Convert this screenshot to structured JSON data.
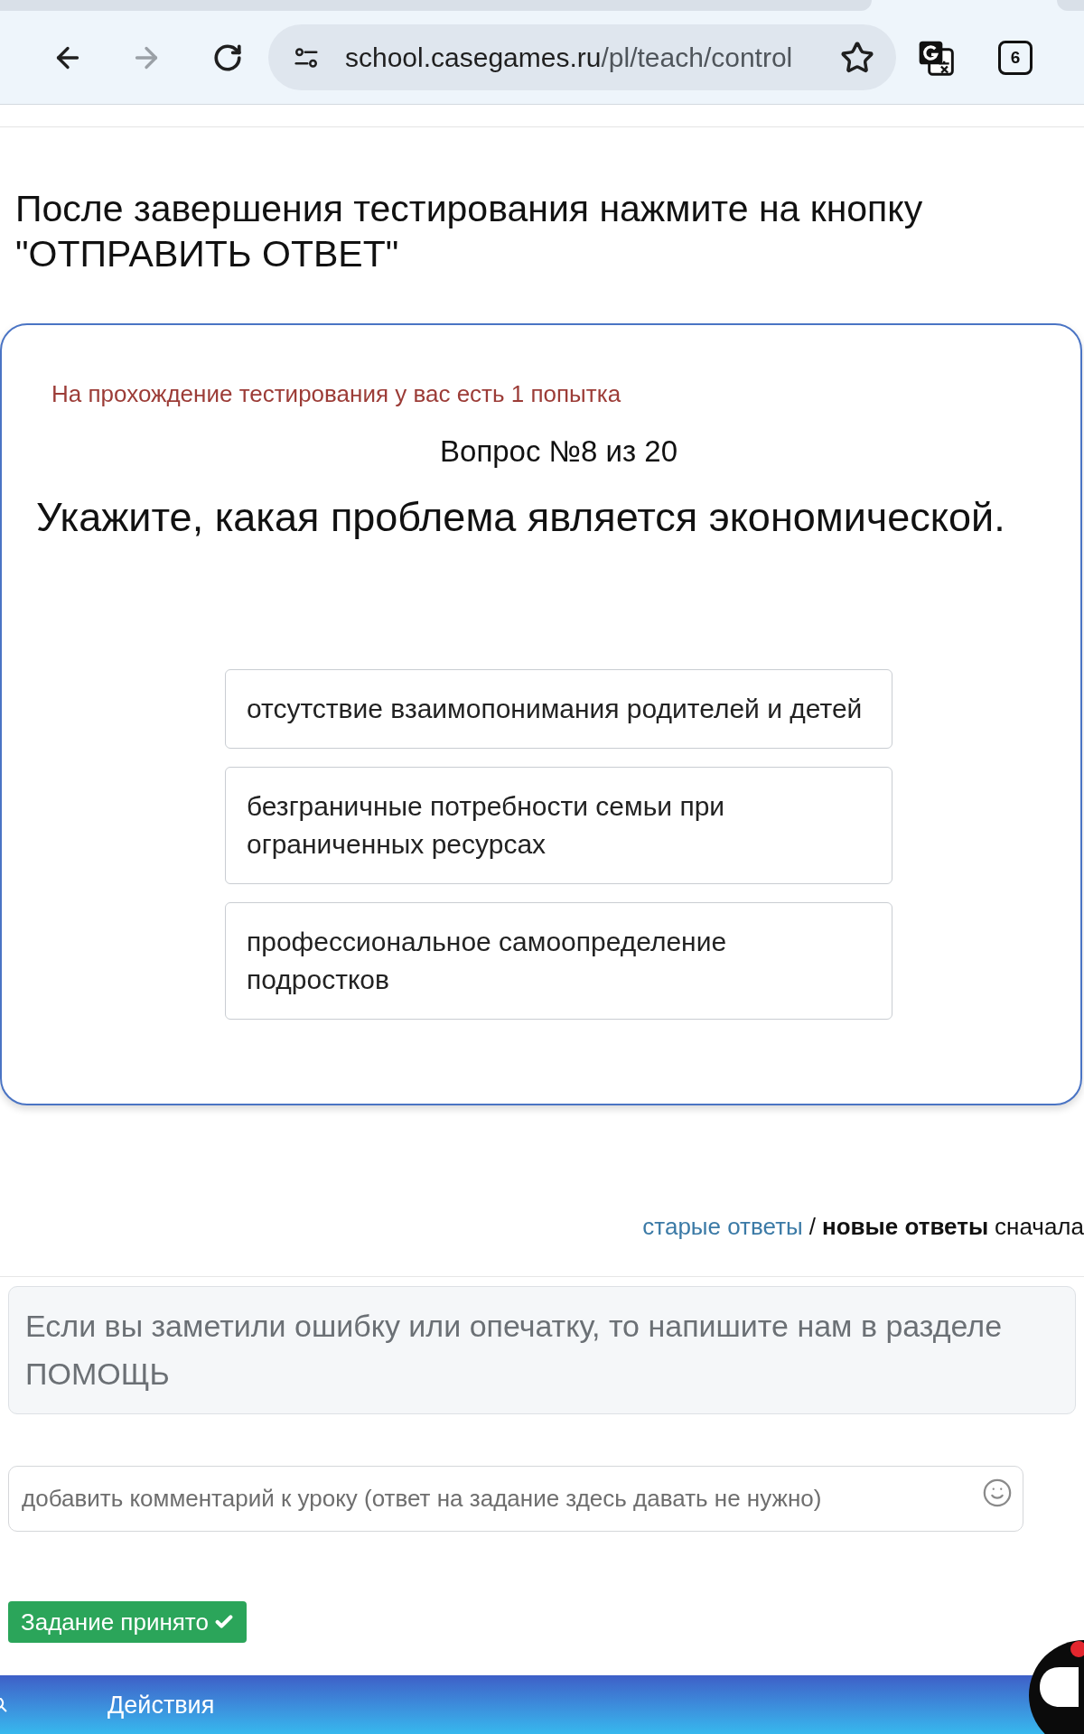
{
  "browser": {
    "forward_disabled": true,
    "address": {
      "host": "school.casegames.ru",
      "path": "/pl/teach/control"
    },
    "tab_count": "6"
  },
  "heading": "После завершения тестирования нажмите на кнопку \"ОТПРАВИТЬ ОТВЕТ\"",
  "test": {
    "attempts_notice": "На прохождение тестирования у вас есть 1 попытка",
    "question_number": "Вопрос №8 из 20",
    "question": "Укажите, какая проблема является экономической.",
    "answers": [
      {
        "text": "отсутствие взаимопонимания родителей и детей",
        "selected": false
      },
      {
        "text": "безграничные потребности семьи при ограниченных ресурсах",
        "selected": false
      },
      {
        "text": "профессиональное самоопределение подростков",
        "selected": false
      }
    ]
  },
  "comments": {
    "sort": {
      "options": [
        {
          "label": "старые ответы",
          "selected": false
        },
        {
          "label": "новые ответы",
          "selected": true
        }
      ],
      "separator": "/",
      "suffix": "сначала"
    },
    "notice": "Если вы заметили ошибку или опечатку, то напишите нам в разделе ПОМОЩЬ",
    "comment_field": {
      "placeholder": "добавить комментарий к уроку (ответ на задание здесь давать не нужно)"
    },
    "status_button": "Задание принято"
  },
  "bottom_bar": {
    "label": "Действия"
  }
}
